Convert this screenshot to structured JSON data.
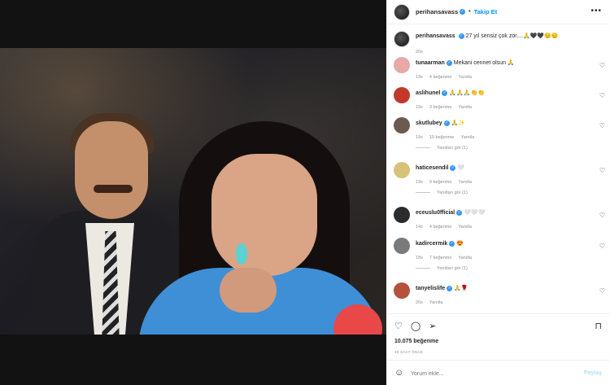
{
  "post": {
    "username": "perihansavass",
    "follow_label": "Takip Et",
    "more_label": "•••",
    "caption": "27 yıl sensiz çok zor....🙏🖤🖤😔😔",
    "caption_time": "20s"
  },
  "comments": [
    {
      "user": "tunaarman",
      "text": "Mekani cennet olsun 🙏",
      "time": "19s",
      "likes": "4 beğenme",
      "reply": "Yanıtla",
      "avatar_color": "#e7a9a9"
    },
    {
      "user": "aslihunel",
      "text": "🙏🙏🙏👏👏",
      "time": "19s",
      "likes": "3 beğenme",
      "reply": "Yanıtla",
      "avatar_color": "#c0392b"
    },
    {
      "user": "skutlubey",
      "text": "🙏✨",
      "time": "19s",
      "likes": "10 beğenme",
      "reply": "Yanıtla",
      "avatar_color": "#6b5a4e",
      "replies_label": "Yanıtları gör (1)"
    },
    {
      "user": "haticesendil",
      "text": "🤍",
      "time": "19s",
      "likes": "9 beğenme",
      "reply": "Yanıtla",
      "avatar_color": "#d8c27a",
      "replies_label": "Yanıtları gör (1)"
    },
    {
      "user": "eceuslu0fficial",
      "text": "🤍🤍🤍",
      "time": "14s",
      "likes": "4 beğenme",
      "reply": "Yanıtla",
      "avatar_color": "#2b2b2b"
    },
    {
      "user": "kadircermik",
      "text": "😍",
      "time": "18s",
      "likes": "7 beğenme",
      "reply": "Yanıtla",
      "avatar_color": "#7a7a7a",
      "replies_label": "Yanıtları gör (1)"
    },
    {
      "user": "tanyelislife",
      "text": "🙏🌹",
      "time": "20s",
      "likes": "",
      "reply": "Yanıtla",
      "avatar_color": "#b5523b"
    }
  ],
  "actions": {
    "likes": "10.075 beğenme",
    "ago": "20 SAAT ÖNCE",
    "comment_placeholder": "Yorum ekle...",
    "post_label": "Paylaş"
  },
  "icons": {
    "like": "heart-icon",
    "comment": "comment-icon",
    "share": "share-icon",
    "save": "bookmark-icon",
    "emoji": "smile-icon",
    "verified": "verified-badge-icon"
  },
  "colors": {
    "link_blue": "#0095f6",
    "verified_blue": "#3897f0",
    "muted": "#8e8e8e"
  }
}
